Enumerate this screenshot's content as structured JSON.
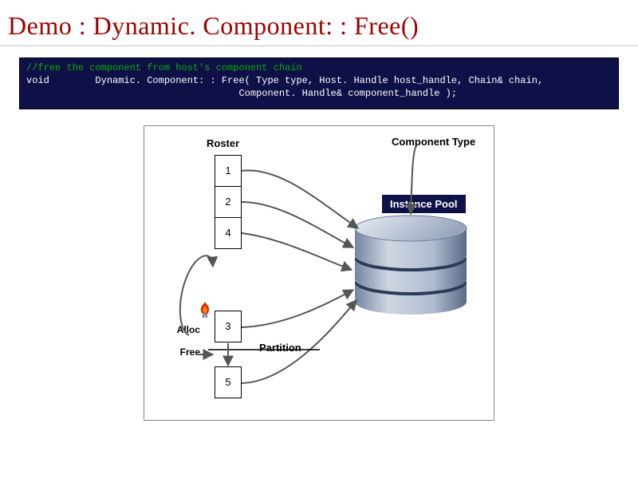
{
  "title": "Demo : Dynamic. Component: : Free()",
  "code": {
    "comment": "//free the component from host's component chain",
    "line1": "void        Dynamic. Component: : Free( Type type, Host. Handle host_handle, Chain& chain,",
    "line2": "                                     Component. Handle& component_handle );"
  },
  "labels": {
    "roster": "Roster",
    "component_type": "Component Type",
    "instance_pool": "Instance Pool",
    "alloc": "Alloc",
    "free": "Free",
    "partition": "Partition"
  },
  "roster_cells": {
    "c1": "1",
    "c2": "2",
    "c3": "4",
    "c4": "3",
    "c5": "5"
  }
}
